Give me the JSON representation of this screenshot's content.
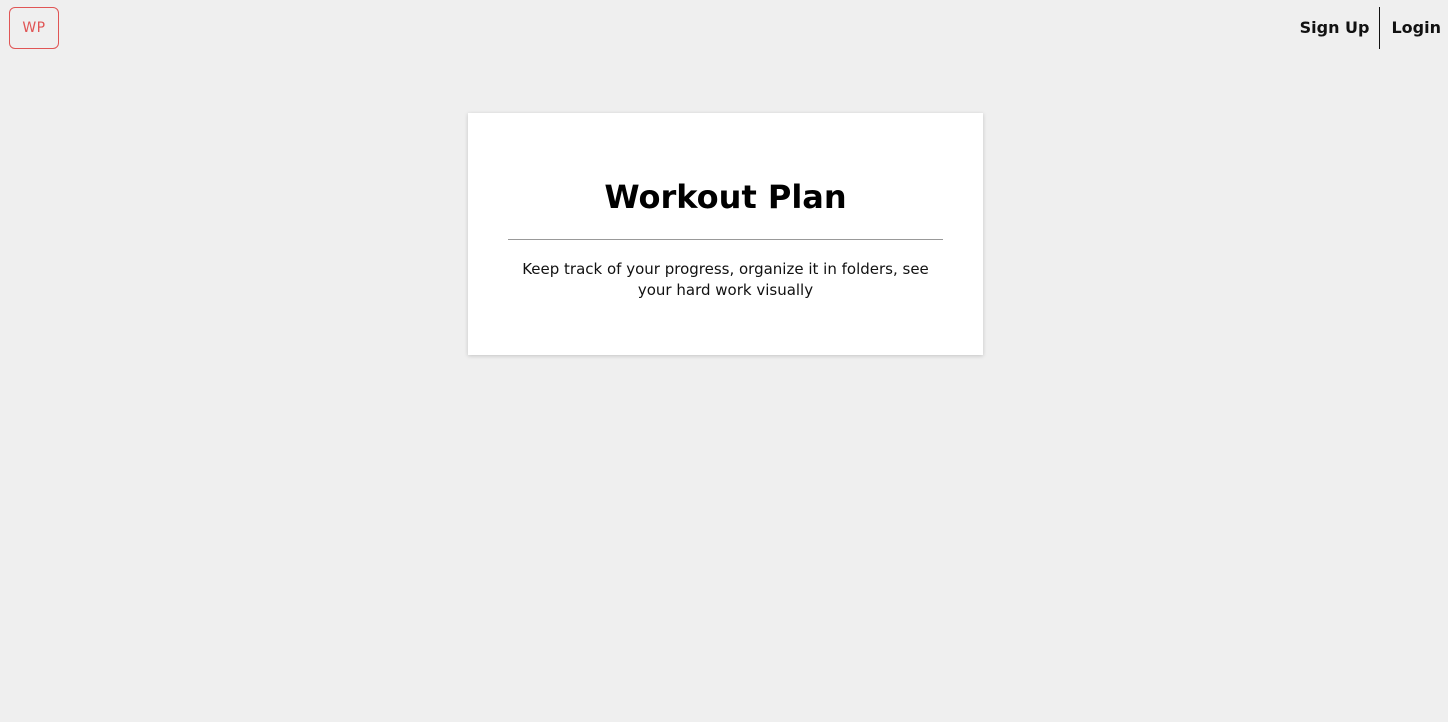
{
  "header": {
    "logo_text": "WP",
    "nav": {
      "signup_label": "Sign Up",
      "login_label": "Login"
    }
  },
  "card": {
    "title": "Workout Plan",
    "description": "Keep track of your progress, organize it in folders, see your hard work visually"
  },
  "colors": {
    "background": "#efefef",
    "card_background": "#ffffff",
    "logo_accent": "#e05555",
    "text": "#111111"
  }
}
